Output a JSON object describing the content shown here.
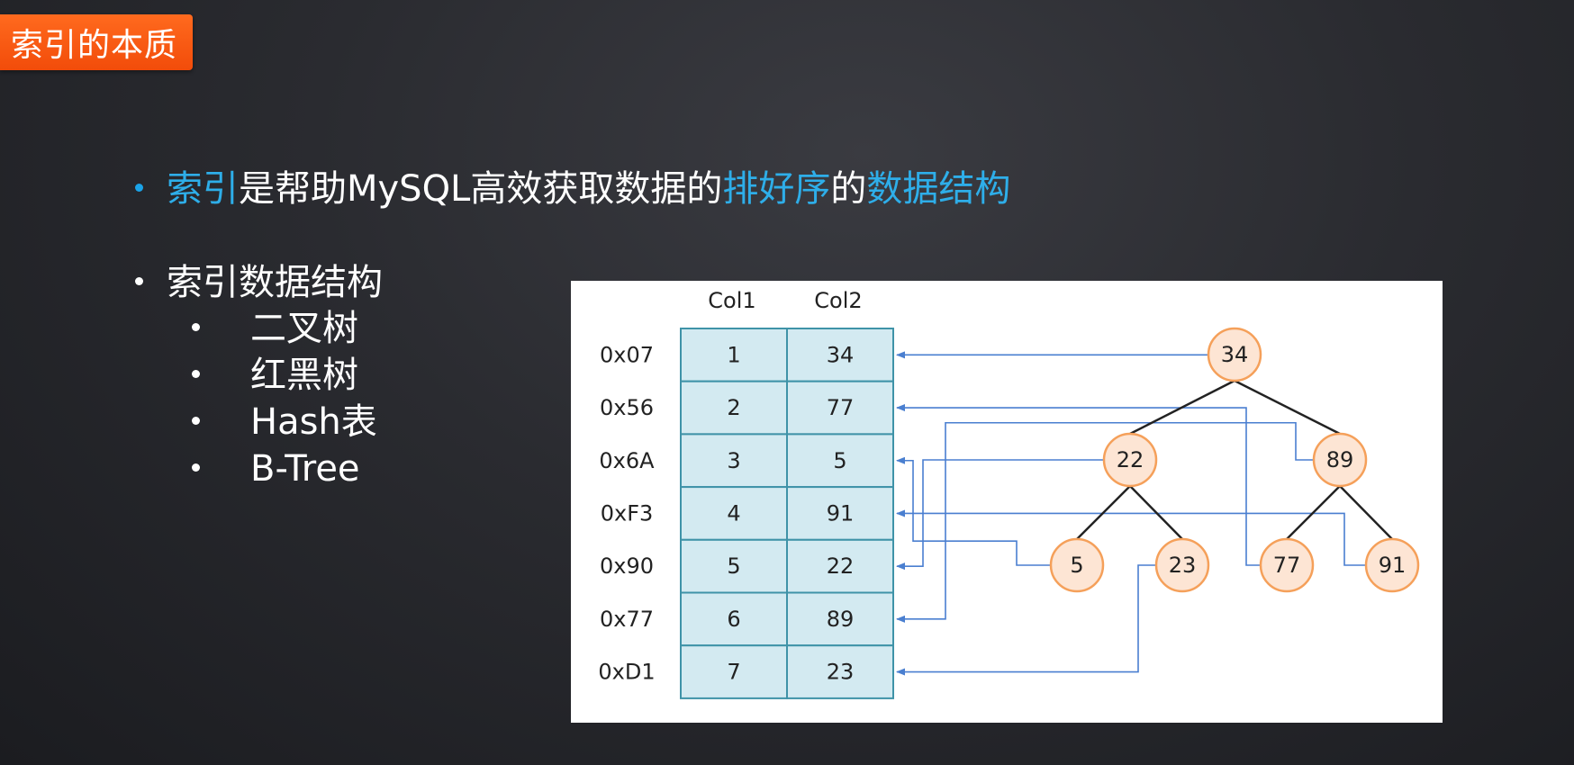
{
  "title": "索引的本质",
  "bullet1": {
    "parts": [
      {
        "text": "索引",
        "highlight": true
      },
      {
        "text": "是帮助MySQL高效获取数据的",
        "highlight": false
      },
      {
        "text": "排好序",
        "highlight": true
      },
      {
        "text": "的",
        "highlight": false
      },
      {
        "text": "数据结构",
        "highlight": true
      }
    ]
  },
  "bullet2": {
    "text": "索引数据结构",
    "items": [
      "二叉树",
      "红黑树",
      "Hash表",
      "B-Tree"
    ]
  },
  "diagram": {
    "columns": [
      "Col1",
      "Col2"
    ],
    "rows": [
      {
        "addr": "0x07",
        "col1": "1",
        "col2": "34"
      },
      {
        "addr": "0x56",
        "col1": "2",
        "col2": "77"
      },
      {
        "addr": "0x6A",
        "col1": "3",
        "col2": "5"
      },
      {
        "addr": "0xF3",
        "col1": "4",
        "col2": "91"
      },
      {
        "addr": "0x90",
        "col1": "5",
        "col2": "22"
      },
      {
        "addr": "0x77",
        "col1": "6",
        "col2": "89"
      },
      {
        "addr": "0xD1",
        "col1": "7",
        "col2": "23"
      }
    ],
    "tree_nodes": [
      "34",
      "22",
      "89",
      "5",
      "23",
      "77",
      "91"
    ],
    "colors": {
      "table_fill": "#d3eaf1",
      "table_border": "#3f93a8",
      "node_fill": "#fde5d4",
      "node_border": "#f5a05a",
      "arrow": "#4a7fd0",
      "tree_edge": "#222222",
      "accent": "#2eaee9",
      "title_bg": "#f55a12"
    }
  }
}
